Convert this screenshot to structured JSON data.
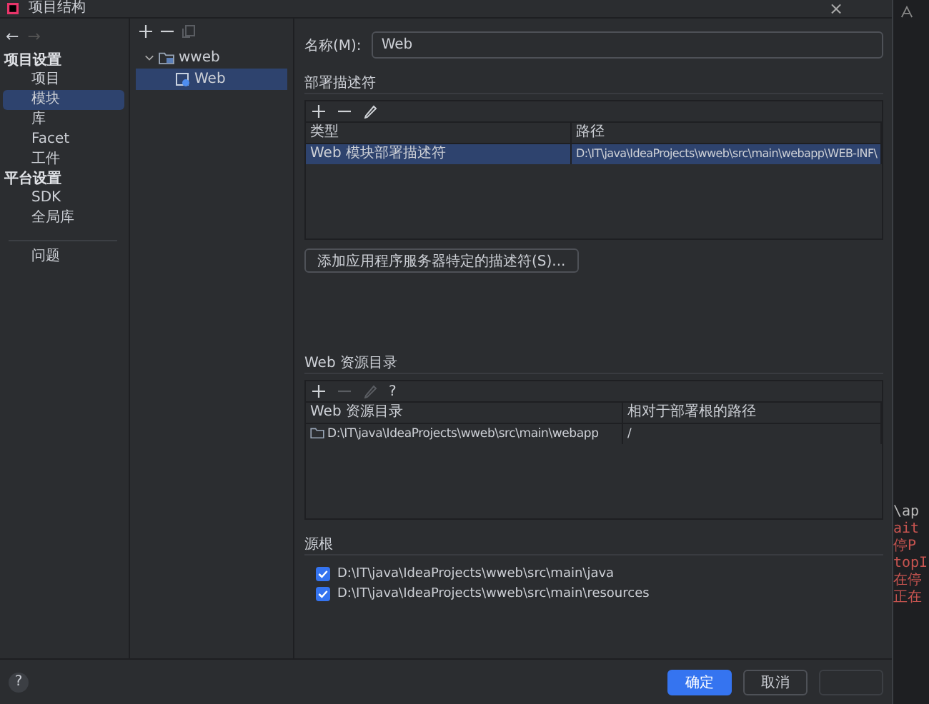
{
  "window": {
    "title": "项目结构",
    "close": "×"
  },
  "nav": [
    {
      "glyph": "←",
      "disabled": false
    },
    {
      "glyph": "→",
      "disabled": true
    }
  ],
  "sidebar": {
    "sections": [
      {
        "heading": "项目设置",
        "items": [
          {
            "label": "项目",
            "selected": false
          },
          {
            "label": "模块",
            "selected": true
          },
          {
            "label": "库",
            "selected": false
          },
          {
            "label": "Facet",
            "selected": false
          },
          {
            "label": "工件",
            "selected": false
          }
        ]
      },
      {
        "heading": "平台设置",
        "items": [
          {
            "label": "SDK",
            "selected": false
          },
          {
            "label": "全局库",
            "selected": false
          }
        ]
      }
    ],
    "extra_items": [
      {
        "label": "问题",
        "selected": false
      }
    ]
  },
  "tree": {
    "nodes": [
      {
        "label": "wweb",
        "expanded": true,
        "selected": false,
        "children": [
          {
            "label": "Web",
            "selected": true
          }
        ]
      }
    ]
  },
  "module": {
    "name_label": "名称(M):",
    "name_value": "Web"
  },
  "deployment_descriptors": {
    "title": "部署描述符",
    "columns": [
      "类型",
      "路径"
    ],
    "rows": [
      {
        "cells": [
          "Web 模块部署描述符",
          "D:\\IT\\java\\IdeaProjects\\wweb\\src\\main\\webapp\\WEB-INF\\"
        ],
        "selected": true
      }
    ],
    "add_button": "添加应用程序服务器特定的描述符(S)..."
  },
  "web_resource_directories": {
    "title": "Web 资源目录",
    "help": "?",
    "columns": [
      "Web 资源目录",
      "相对于部署根的路径"
    ],
    "rows": [
      {
        "cells": [
          "D:\\IT\\java\\IdeaProjects\\wweb\\src\\main\\webapp",
          "/"
        ],
        "selected": false
      }
    ]
  },
  "source_roots": {
    "title": "源根",
    "items": [
      {
        "path": "D:\\IT\\java\\IdeaProjects\\wweb\\src\\main\\java",
        "checked": true
      },
      {
        "path": "D:\\IT\\java\\IdeaProjects\\wweb\\src\\main\\resources",
        "checked": true
      }
    ]
  },
  "help": "?",
  "buttons": [
    {
      "label": "确定",
      "kind": "primary"
    },
    {
      "label": "取消",
      "kind": "normal"
    },
    {
      "kind": "disabled"
    }
  ],
  "background_editor": {
    "lines": [
      {
        "text": "\\ap",
        "kind": "plain"
      },
      {
        "text": "ait",
        "kind": "red"
      },
      {
        "text": "停P",
        "kind": "red"
      },
      {
        "text": "topI",
        "kind": "red"
      },
      {
        "text": "在停",
        "kind": "red"
      },
      {
        "text": "正在",
        "kind": "red"
      }
    ]
  }
}
